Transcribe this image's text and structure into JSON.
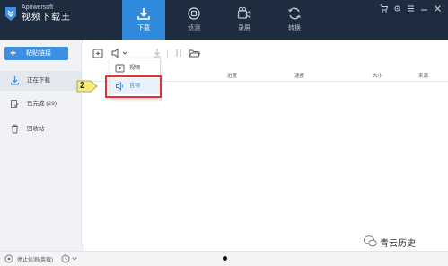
{
  "app": {
    "brand_en": "Apowersoft",
    "brand_cn": "视频下载王"
  },
  "header": {
    "tabs": [
      {
        "label": "下载",
        "icon": "download-icon",
        "active": true
      },
      {
        "label": "侦测",
        "icon": "detect-icon",
        "active": false
      },
      {
        "label": "录屏",
        "icon": "record-icon",
        "active": false
      },
      {
        "label": "转换",
        "icon": "convert-icon",
        "active": false
      }
    ]
  },
  "sidebar": {
    "new_label": "粘贴链接",
    "items": [
      {
        "label": "正在下载",
        "icon": "download-arrow-icon"
      },
      {
        "label": "已完成 (29)",
        "icon": "completed-icon"
      },
      {
        "label": "回收站",
        "icon": "trash-icon"
      }
    ]
  },
  "table": {
    "columns": [
      "进度",
      "速度",
      "大小",
      "来源"
    ]
  },
  "dropdown": {
    "items": [
      {
        "label": "视频",
        "icon": "video-icon"
      },
      {
        "label": "音频",
        "icon": "audio-icon"
      }
    ]
  },
  "callout": {
    "number": "2"
  },
  "status": {
    "text": "停止侦测(英载)"
  },
  "watermark": {
    "text": "青云历史"
  },
  "colors": {
    "header_bg": "#1e2c3f",
    "accent": "#2f89dc",
    "callout": "#e03333"
  }
}
